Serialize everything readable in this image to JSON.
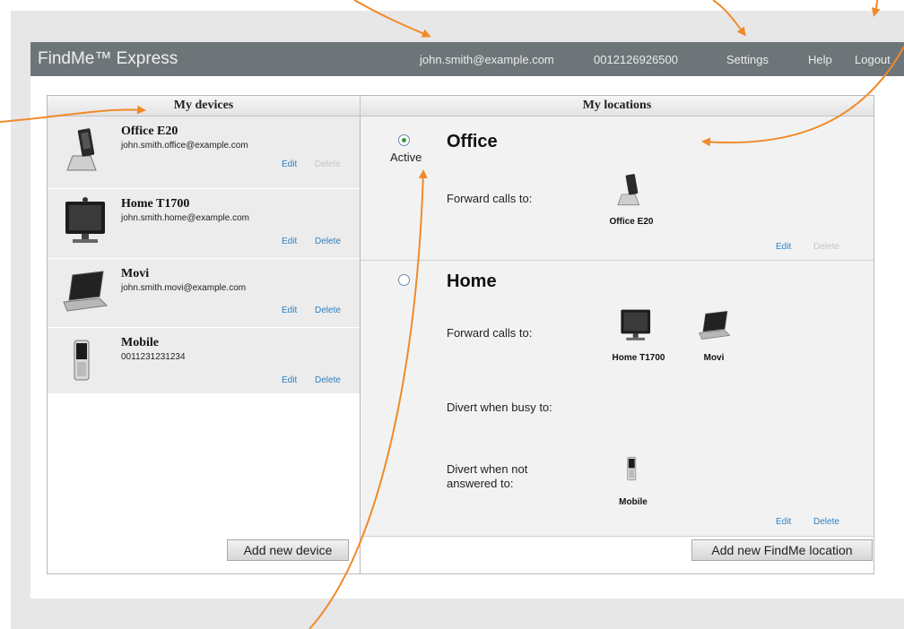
{
  "header": {
    "brand": "FindMe™ Express",
    "email": "john.smith@example.com",
    "phone": "0012126926500",
    "settings": "Settings",
    "help": "Help",
    "logout": "Logout"
  },
  "devices": {
    "title": "My devices",
    "items": [
      {
        "name": "Office E20",
        "address": "john.smith.office@example.com",
        "edit": "Edit",
        "delete": "Delete",
        "icon": "desk-videophone-icon"
      },
      {
        "name": "Home T1700",
        "address": "john.smith.home@example.com",
        "edit": "Edit",
        "delete": "Delete",
        "icon": "monitor-videophone-icon"
      },
      {
        "name": "Movi",
        "address": "john.smith.movi@example.com",
        "edit": "Edit",
        "delete": "Delete",
        "icon": "laptop-icon"
      },
      {
        "name": "Mobile",
        "address": "0011231231234",
        "edit": "Edit",
        "delete": "Delete",
        "icon": "mobile-phone-icon"
      }
    ],
    "add_button": "Add new device"
  },
  "locations": {
    "title": "My locations",
    "items": [
      {
        "name": "Office",
        "status": "Active",
        "selected": true,
        "forward_label": "Forward calls to:",
        "forward_devices": [
          "Office E20"
        ],
        "edit": "Edit",
        "delete": "Delete"
      },
      {
        "name": "Home",
        "selected": false,
        "forward_label": "Forward calls to:",
        "forward_devices": [
          "Home T1700",
          "Movi"
        ],
        "busy_label": "Divert when busy to:",
        "noanswer_label": "Divert when not answered to:",
        "noanswer_devices": [
          "Mobile"
        ],
        "edit": "Edit",
        "delete": "Delete"
      }
    ],
    "add_button": "Add new FindMe location"
  },
  "colors": {
    "titlebar": "#6e7579",
    "link": "#2f7fbf",
    "arrow": "#f08a2a",
    "active_radio": "#2f9a3a"
  }
}
